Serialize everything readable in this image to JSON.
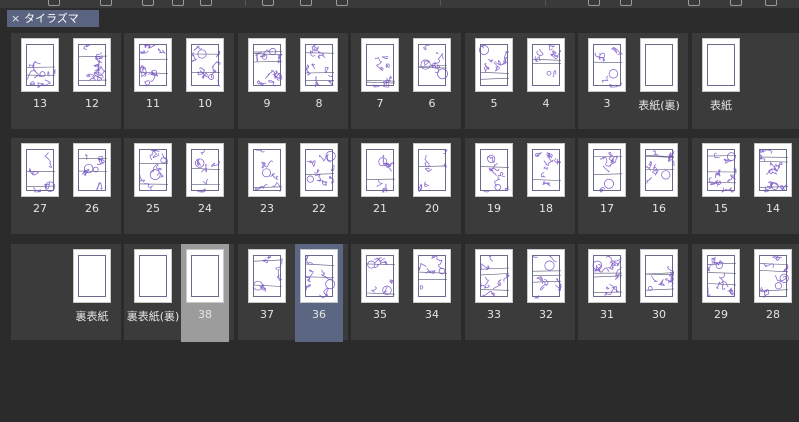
{
  "tab": {
    "title": "タイラズマ",
    "close_icon": "close-icon"
  },
  "colors": {
    "background": "#2b2b2b",
    "spread": "#3b3b3b",
    "tab_active": "#5a6480",
    "selected_gray": "#9c9c9c",
    "selected_blue": "#5b6782",
    "sketch": "#7a55c8"
  },
  "rows": [
    {
      "spreads": [
        {
          "pages": [
            {
              "label": "13",
              "type": "sketch"
            },
            {
              "label": "12",
              "type": "sketch"
            }
          ]
        },
        {
          "pages": [
            {
              "label": "11",
              "type": "sketch"
            },
            {
              "label": "10",
              "type": "sketch"
            }
          ]
        },
        {
          "pages": [
            {
              "label": "9",
              "type": "sketch"
            },
            {
              "label": "8",
              "type": "sketch"
            }
          ]
        },
        {
          "pages": [
            {
              "label": "7",
              "type": "sketch"
            },
            {
              "label": "6",
              "type": "sketch"
            }
          ]
        },
        {
          "pages": [
            {
              "label": "5",
              "type": "sketch"
            },
            {
              "label": "4",
              "type": "sketch"
            }
          ]
        },
        {
          "pages": [
            {
              "label": "3",
              "type": "sketch"
            },
            {
              "label": "表紙(裏)",
              "type": "blank"
            }
          ]
        },
        {
          "pages": [
            {
              "label": "表紙",
              "type": "blank"
            }
          ]
        }
      ]
    },
    {
      "spreads": [
        {
          "pages": [
            {
              "label": "27",
              "type": "sketch"
            },
            {
              "label": "26",
              "type": "sketch"
            }
          ]
        },
        {
          "pages": [
            {
              "label": "25",
              "type": "sketch"
            },
            {
              "label": "24",
              "type": "sketch"
            }
          ]
        },
        {
          "pages": [
            {
              "label": "23",
              "type": "sketch"
            },
            {
              "label": "22",
              "type": "sketch"
            }
          ]
        },
        {
          "pages": [
            {
              "label": "21",
              "type": "sketch"
            },
            {
              "label": "20",
              "type": "sketch"
            }
          ]
        },
        {
          "pages": [
            {
              "label": "19",
              "type": "sketch"
            },
            {
              "label": "18",
              "type": "sketch"
            }
          ]
        },
        {
          "pages": [
            {
              "label": "17",
              "type": "sketch"
            },
            {
              "label": "16",
              "type": "sketch"
            }
          ]
        },
        {
          "pages": [
            {
              "label": "15",
              "type": "sketch"
            },
            {
              "label": "14",
              "type": "sketch"
            }
          ]
        }
      ]
    },
    {
      "spreads": [
        {
          "pages": [
            {
              "label": "裏表紙",
              "type": "blank"
            }
          ]
        },
        {
          "pages": [
            {
              "label": "裏表紙(裏)",
              "type": "blank"
            },
            {
              "label": "38",
              "type": "blank",
              "selected": "gray"
            }
          ]
        },
        {
          "pages": [
            {
              "label": "37",
              "type": "sketch"
            },
            {
              "label": "36",
              "type": "sketch",
              "selected": "blue"
            }
          ]
        },
        {
          "pages": [
            {
              "label": "35",
              "type": "sketch"
            },
            {
              "label": "34",
              "type": "sketch"
            }
          ]
        },
        {
          "pages": [
            {
              "label": "33",
              "type": "sketch"
            },
            {
              "label": "32",
              "type": "sketch"
            }
          ]
        },
        {
          "pages": [
            {
              "label": "31",
              "type": "sketch"
            },
            {
              "label": "30",
              "type": "sketch"
            }
          ]
        },
        {
          "pages": [
            {
              "label": "29",
              "type": "sketch"
            },
            {
              "label": "28",
              "type": "sketch"
            }
          ]
        }
      ]
    }
  ]
}
